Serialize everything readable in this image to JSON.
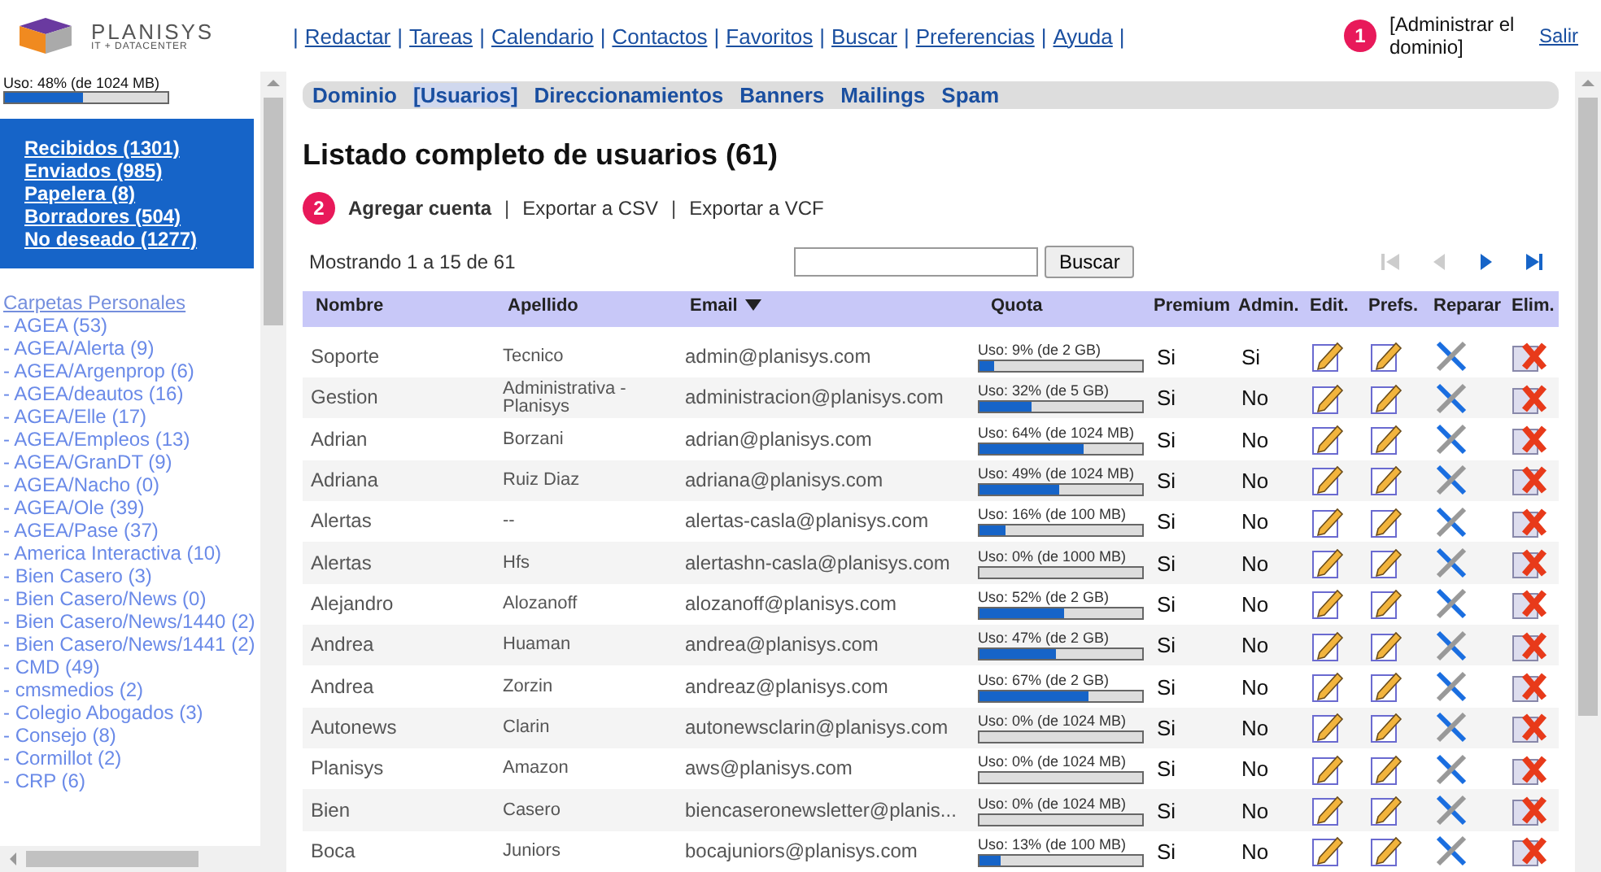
{
  "logo": {
    "name": "PLANISYS",
    "tagline": "IT + DATACENTER"
  },
  "menu_separator": "|",
  "top_menu": [
    "Redactar",
    "Tareas",
    "Calendario",
    "Contactos",
    "Favoritos",
    "Buscar",
    "Preferencias",
    "Ayuda"
  ],
  "top_right": {
    "badge": "1",
    "admin_link": "[Administrar el dominio]",
    "logout": "Salir"
  },
  "sidebar": {
    "usage": {
      "label": "Uso: 48% (de 1024 MB)",
      "level": 0.48
    },
    "mailboxes": [
      "Recibidos (1301)",
      "Enviados (985)",
      "Papelera (8)",
      "Borradores (504)",
      "No deseado (1277)"
    ],
    "folders_title": "Carpetas Personales",
    "folders": [
      "- AGEA (53)",
      "- AGEA/Alerta (9)",
      "- AGEA/Argenprop (6)",
      "- AGEA/deautos (16)",
      "- AGEA/Elle (17)",
      "- AGEA/Empleos (13)",
      "- AGEA/GranDT (9)",
      "- AGEA/Nacho (0)",
      "- AGEA/Ole (39)",
      "- AGEA/Pase (37)",
      "- America Interactiva (10)",
      "- Bien Casero (3)",
      "- Bien Casero/News (0)",
      "- Bien Casero/News/1440 (2)",
      "- Bien Casero/News/1441 (2)",
      "- CMD (49)",
      "- cmsmedios (2)",
      "- Colegio Abogados (3)",
      "- Consejo (8)",
      "- Cormillot (2)",
      "- CRP (6)"
    ]
  },
  "tabs": [
    {
      "label": "Dominio",
      "selected": false
    },
    {
      "label": "[Usuarios]",
      "selected": true
    },
    {
      "label": "Direccionamientos",
      "selected": false
    },
    {
      "label": "Banners",
      "selected": false
    },
    {
      "label": "Mailings",
      "selected": false
    },
    {
      "label": "Spam",
      "selected": false
    }
  ],
  "title": "Listado completo de usuarios (61)",
  "actions": {
    "badge": "2",
    "separator": "|",
    "items": [
      "Agregar cuenta",
      "Exportar a CSV",
      "Exportar a VCF"
    ]
  },
  "search": {
    "showing": "Mostrando 1 a 15 de 61",
    "button": "Buscar"
  },
  "pager": [
    {
      "kind": "first",
      "disabled": true
    },
    {
      "kind": "prev",
      "disabled": true
    },
    {
      "kind": "next",
      "disabled": false
    },
    {
      "kind": "last",
      "disabled": false
    }
  ],
  "table": {
    "columns": [
      "Nombre",
      "Apellido",
      "Email",
      "Quota",
      "Premium",
      "Admin.",
      "Edit.",
      "Prefs.",
      "Reparar",
      "Elim."
    ],
    "rows": [
      {
        "name": "Soporte",
        "surname": "Tecnico",
        "email": "admin@planisys.com",
        "quota": "Uso: 9% (de 2 GB)",
        "level": 0.09,
        "premium": "Si",
        "admin": "Si"
      },
      {
        "name": "Gestion",
        "surname": "Administrativa - Planisys",
        "email": "administracion@planisys.com",
        "quota": "Uso: 32% (de 5 GB)",
        "level": 0.32,
        "premium": "Si",
        "admin": "No"
      },
      {
        "name": "Adrian",
        "surname": "Borzani",
        "email": "adrian@planisys.com",
        "quota": "Uso: 64% (de 1024 MB)",
        "level": 0.64,
        "premium": "Si",
        "admin": "No"
      },
      {
        "name": "Adriana",
        "surname": "Ruiz Diaz",
        "email": "adriana@planisys.com",
        "quota": "Uso: 49% (de 1024 MB)",
        "level": 0.49,
        "premium": "Si",
        "admin": "No"
      },
      {
        "name": "Alertas",
        "surname": "--",
        "email": "alertas-casla@planisys.com",
        "quota": "Uso: 16% (de 100 MB)",
        "level": 0.16,
        "premium": "Si",
        "admin": "No"
      },
      {
        "name": "Alertas",
        "surname": "Hfs",
        "email": "alertashn-casla@planisys.com",
        "quota": "Uso: 0% (de 1000 MB)",
        "level": 0,
        "premium": "Si",
        "admin": "No"
      },
      {
        "name": "Alejandro",
        "surname": "Alozanoff",
        "email": "alozanoff@planisys.com",
        "quota": "Uso: 52% (de 2 GB)",
        "level": 0.52,
        "premium": "Si",
        "admin": "No"
      },
      {
        "name": "Andrea",
        "surname": "Huaman",
        "email": "andrea@planisys.com",
        "quota": "Uso: 47% (de 2 GB)",
        "level": 0.47,
        "premium": "Si",
        "admin": "No"
      },
      {
        "name": "Andrea",
        "surname": "Zorzin",
        "email": "andreaz@planisys.com",
        "quota": "Uso: 67% (de 2 GB)",
        "level": 0.67,
        "premium": "Si",
        "admin": "No"
      },
      {
        "name": "Autonews",
        "surname": "Clarin",
        "email": "autonewsclarin@planisys.com",
        "quota": "Uso: 0% (de 1024 MB)",
        "level": 0,
        "premium": "Si",
        "admin": "No"
      },
      {
        "name": "Planisys",
        "surname": "Amazon",
        "email": "aws@planisys.com",
        "quota": "Uso: 0% (de 1024 MB)",
        "level": 0,
        "premium": "Si",
        "admin": "No"
      },
      {
        "name": "Bien",
        "surname": "Casero",
        "email": "biencaseronewsletter@planis...",
        "quota": "Uso: 0% (de 1024 MB)",
        "level": 0,
        "premium": "Si",
        "admin": "No"
      },
      {
        "name": "Boca",
        "surname": "Juniors",
        "email": "bocajuniors@planisys.com",
        "quota": "Uso: 13% (de 100 MB)",
        "level": 0.13,
        "premium": "Si",
        "admin": "No"
      }
    ]
  }
}
